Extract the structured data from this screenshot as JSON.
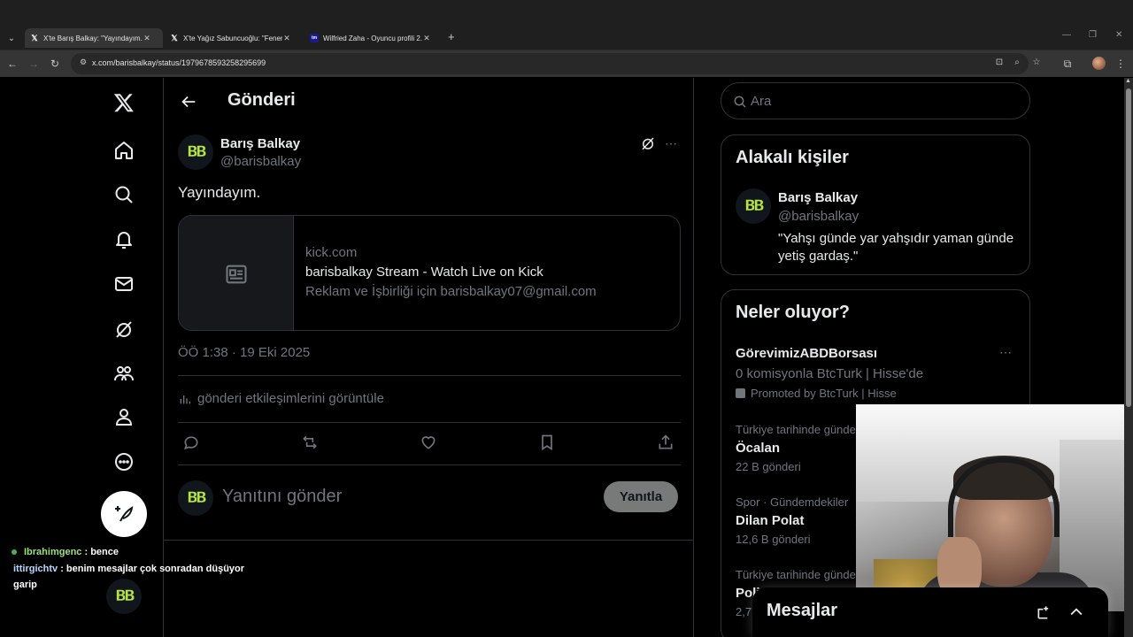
{
  "browser": {
    "tabs": [
      {
        "label": "X'te Barış Balkay: \"Yayındayım. ...",
        "active": true,
        "favicon": "x-icon"
      },
      {
        "label": "X'te Yağız Sabuncuoğlu: \"Fener...",
        "active": false,
        "favicon": "x-icon"
      },
      {
        "label": "Wilfried Zaha - Oyuncu profili 2...",
        "active": false,
        "favicon": "transfermarkt-icon"
      }
    ],
    "url": "x.com/barisbalkay/status/1979678593258295699"
  },
  "nav": {
    "items": [
      "x-logo-icon",
      "home-icon",
      "explore-icon",
      "notifications-icon",
      "messages-icon",
      "grok-icon",
      "communities-icon",
      "profile-icon",
      "more-icon",
      "post-icon"
    ]
  },
  "main": {
    "title": "Gönderi",
    "post": {
      "name": "Barış Balkay",
      "handle": "@barisbalkay",
      "text": "Yayındayım.",
      "avatar_text": "BB",
      "card": {
        "domain": "kick.com",
        "title": "barisbalkay Stream - Watch Live on Kick",
        "description": "Reklam ve İşbirliği için barisbalkay07@gmail.com"
      },
      "timestamp": "ÖÖ 1:38 · 19 Eki 2025",
      "engagements_link": "gönderi etkileşimlerini görüntüle"
    },
    "reply": {
      "placeholder": "Yanıtını gönder",
      "button": "Yanıtla"
    }
  },
  "right": {
    "search_placeholder": "Ara",
    "related": {
      "title": "Alakalı kişiler",
      "name": "Barış Balkay",
      "handle": "@barisbalkay",
      "bio": "\"Yahşı günde yar yahşıdır yaman günde yetiş gardaş.\""
    },
    "trends": {
      "title": "Neler oluyor?",
      "promoted": {
        "name": "GörevimizABDBorsası",
        "subtitle": "0 komisyonla BtcTurk | Hisse'de",
        "promoted_by": "Promoted by BtcTurk | Hisse"
      },
      "items": [
        {
          "context": "Türkiye tarihinde gündem",
          "name": "Öcalan",
          "count": "22 B gönderi"
        },
        {
          "context": "Spor · Gündemdekiler",
          "name": "Dilan Polat",
          "count": "12,6 B gönderi"
        },
        {
          "context": "Türkiye tarihinde gündem",
          "name": "Poli",
          "count": "2,7"
        }
      ]
    },
    "messages_dock_title": "Mesajlar"
  },
  "chat_overlay": [
    {
      "user": "Ibrahimgenc",
      "text": ": bence"
    },
    {
      "user": "ittirgichtv",
      "text": ": benim mesajlar çok sonradan düşüyor garip"
    }
  ]
}
